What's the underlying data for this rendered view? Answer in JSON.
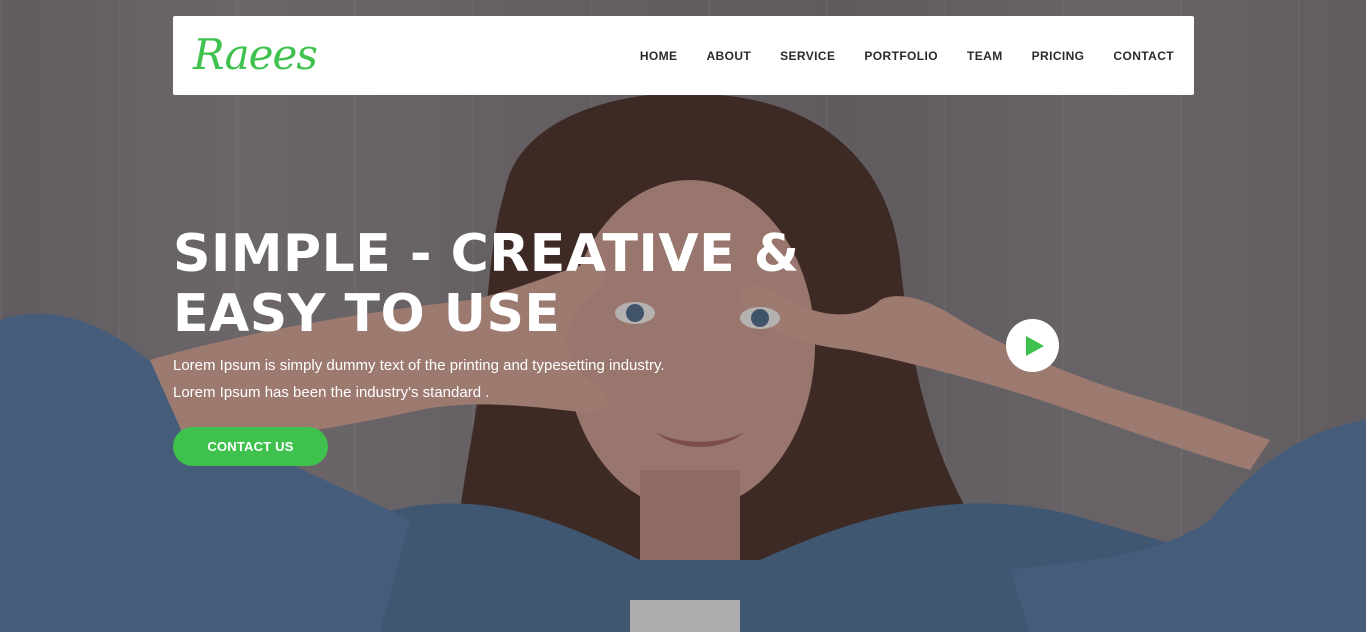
{
  "brand": {
    "logo_text": "Raees",
    "accent_color": "#3fc24d"
  },
  "nav": {
    "items": [
      {
        "label": "HOME"
      },
      {
        "label": "ABOUT"
      },
      {
        "label": "SERVICE"
      },
      {
        "label": "PORTFOLIO"
      },
      {
        "label": "TEAM"
      },
      {
        "label": "PRICING"
      },
      {
        "label": "CONTACT"
      }
    ]
  },
  "hero": {
    "headline_line1": "SIMPLE - CREATIVE &",
    "headline_line2": "EASY TO USE",
    "description_line1": "Lorem Ipsum is simply dummy text of the printing and typesetting industry.",
    "description_line2": "Lorem Ipsum has been the industry's standard .",
    "cta_label": "CONTACT US",
    "play_icon": "play-icon",
    "background_image": "woman-peace-sign-photo"
  }
}
